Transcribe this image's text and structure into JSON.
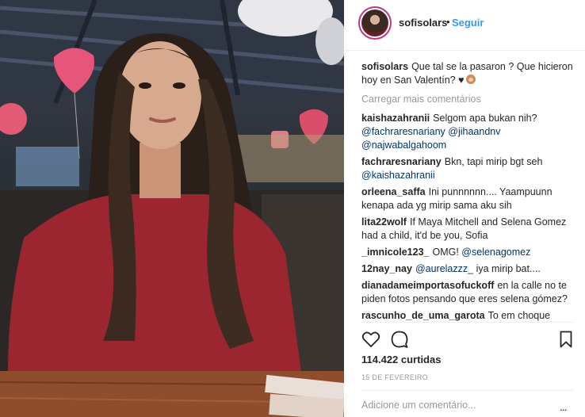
{
  "post": {
    "username": "sofisolars",
    "follow_label": "Seguir",
    "separator": "•",
    "caption": {
      "username": "sofisolars",
      "text": "Que tal se la pasaron ? Que hicieron hoy en San Valentín? ♥"
    },
    "load_more_label": "Carregar mais comentários",
    "comments": [
      {
        "username": "kaishazahranii",
        "text": "Selgom apa bukan nih?",
        "mentions": [
          "@fachraresnariany",
          "@jihaandnv",
          "@najwabalgahoom"
        ]
      },
      {
        "username": "fachraresnariany",
        "text": "Bkn, tapi mirip bgt seh",
        "mentions": [
          "@kaishazahranii"
        ]
      },
      {
        "username": "orleena_saffa",
        "text": "Ini punnnnnn.... Yaampuunn kenapa ada yg mirip sama aku sih"
      },
      {
        "username": "lita22wolf",
        "text": "If Maya Mitchell and Selena Gomez had a child, it'd be you, Sofia"
      },
      {
        "username": "_imnicole123_",
        "text": "OMG!",
        "mentions": [
          "@selenagomez"
        ]
      },
      {
        "username": "12nay_nay",
        "mention_first": "@aurelazzz_",
        "text": "iya mirip bat...."
      },
      {
        "username": "dianadameimportasofuckoff",
        "text": "en la calle no te piden fotos pensando que eres selena gómez?"
      },
      {
        "username": "rascunho_de_uma_garota",
        "text": "To em choque"
      }
    ],
    "likes": "114.422 curtidas",
    "date": "15 DE FEVEREIRO",
    "add_comment_placeholder": "Adicione um comentário...",
    "more_label": "..."
  },
  "icons": {
    "like": "heart-icon",
    "comment": "comment-bubble-icon",
    "save": "bookmark-icon"
  },
  "colors": {
    "link": "#3897f0",
    "mention": "#003569",
    "muted": "#999999",
    "text": "#262626"
  }
}
